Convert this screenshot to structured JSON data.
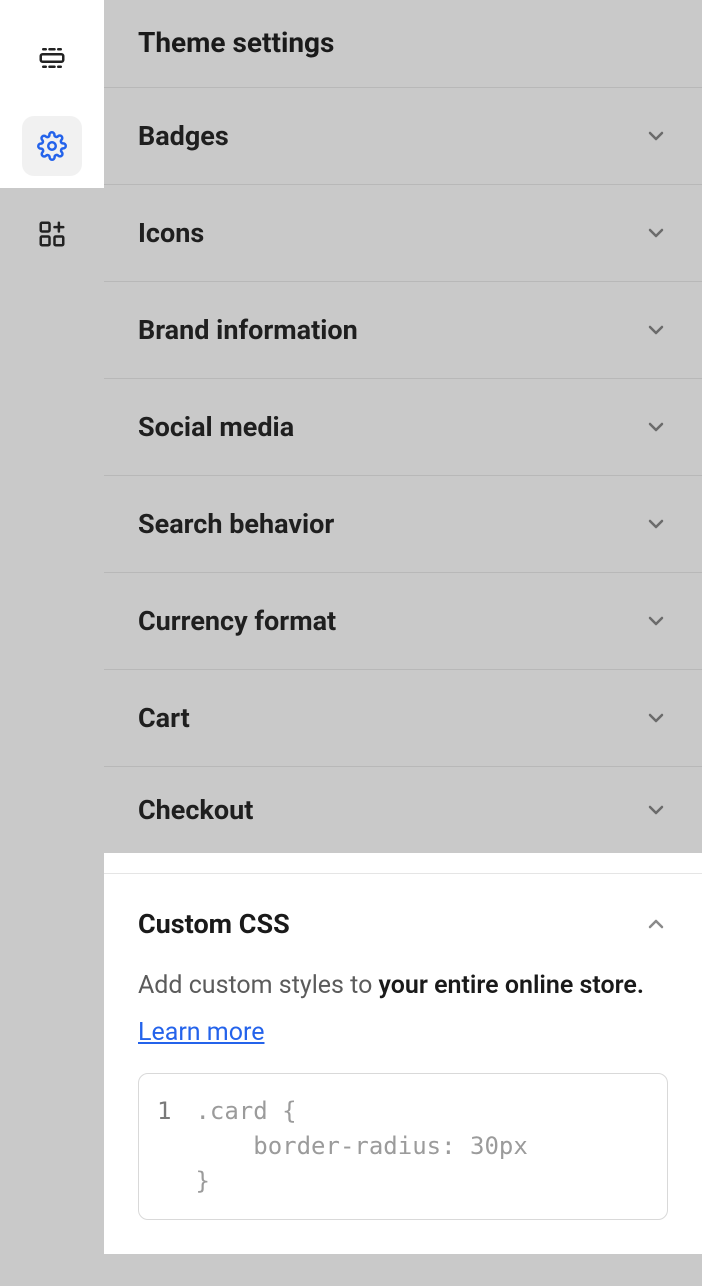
{
  "header": {
    "title": "Theme settings"
  },
  "sections": [
    {
      "label": "Badges",
      "expanded": false
    },
    {
      "label": "Icons",
      "expanded": false
    },
    {
      "label": "Brand information",
      "expanded": false
    },
    {
      "label": "Social media",
      "expanded": false
    },
    {
      "label": "Search behavior",
      "expanded": false
    },
    {
      "label": "Currency format",
      "expanded": false
    },
    {
      "label": "Cart",
      "expanded": false
    },
    {
      "label": "Checkout",
      "expanded": false
    }
  ],
  "customCss": {
    "title": "Custom CSS",
    "desc_prefix": "Add custom styles to ",
    "desc_bold": "your entire online store.",
    "learn_more": "Learn more",
    "line_number": "1",
    "code": ".card {\n    border-radius: 30px\n}"
  },
  "rail": {
    "sections_icon": "sections-icon",
    "settings_icon": "gear-icon",
    "apps_icon": "apps-icon"
  }
}
